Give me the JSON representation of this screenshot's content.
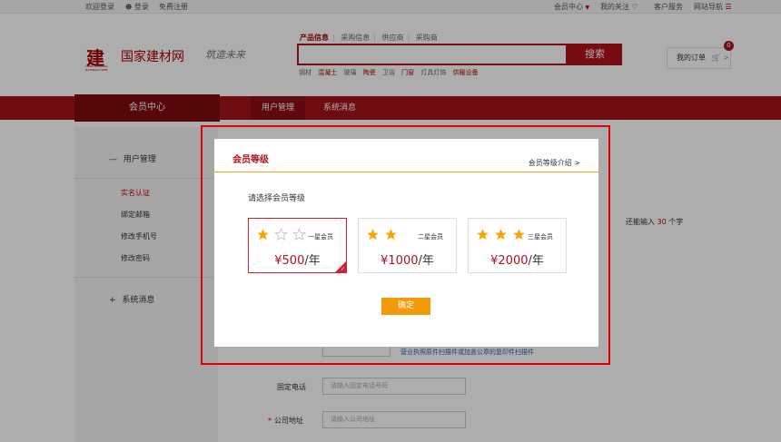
{
  "topbar": {
    "welcome": "欢迎登录",
    "login": "登录",
    "register": "免费注册",
    "member_center": "会员中心",
    "my_follow": "我的关注",
    "customer_service": "客户服务",
    "site_nav": "网站导航"
  },
  "header": {
    "logo_mark": "建",
    "logo_sub": "CHINA BUILDING MATERIALS WEB",
    "logo_text": "国家建材网",
    "slogan": "筑造未来",
    "search_tabs": [
      "产品信息",
      "采购信息",
      "供应商",
      "采购商"
    ],
    "search_button": "搜索",
    "hot_words": [
      "钢材",
      "混凝土",
      "玻璃",
      "陶瓷",
      "卫浴",
      "门窗",
      "灯具灯饰",
      "供暖设备"
    ],
    "hot_highlight": [
      false,
      true,
      false,
      true,
      false,
      true,
      false,
      true
    ],
    "my_order": "我的订单",
    "cart_count": "0"
  },
  "nav": {
    "member_center": "会员中心",
    "tabs": [
      "用户管理",
      "系统消息"
    ]
  },
  "sidebar": {
    "section1": "用户管理",
    "items": [
      "实名认证",
      "绑定邮箱",
      "修改手机号",
      "修改密码"
    ],
    "section2": "系统消息"
  },
  "form": {
    "remain_prefix": "还能输入",
    "remain_count": "30",
    "remain_suffix": "个字",
    "upload_hint": "营业执照原件扫描件或加盖公章的复印件扫描件",
    "phone_label": "固定电话",
    "phone_placeholder": "请输入固定电话号码",
    "address_label": "公司地址",
    "address_placeholder": "请输入公司地址",
    "required_mark": "*"
  },
  "modal": {
    "title": "会员等级",
    "intro_link": "会员等级介绍 >",
    "prompt": "请选择会员等级",
    "levels": [
      {
        "name": "一星会员",
        "price": "¥500",
        "unit": "/年",
        "stars": 1,
        "selected": true
      },
      {
        "name": "二星会员",
        "price": "¥1000",
        "unit": "/年",
        "stars": 2,
        "selected": false
      },
      {
        "name": "三星会员",
        "price": "¥2000",
        "unit": "/年",
        "stars": 3,
        "selected": false
      }
    ],
    "confirm": "确定"
  },
  "colors": {
    "brand_red": "#b0121b",
    "highlight_red": "#e00000",
    "star_gold": "#f5a400",
    "confirm_orange": "#f39a0b"
  },
  "icons": [
    "user-icon",
    "chevron-down-icon",
    "heart-icon",
    "list-icon",
    "cart-icon",
    "star-filled-icon",
    "star-empty-icon",
    "check-icon",
    "minus-icon",
    "plus-icon"
  ]
}
